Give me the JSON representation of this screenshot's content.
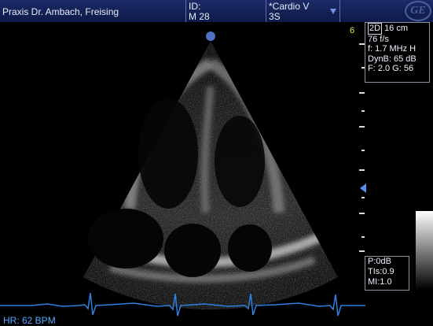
{
  "header": {
    "practice": "Praxis Dr. Ambach,  Freising",
    "patient_id_label": "ID:",
    "patient_id_value": "M 28",
    "preset": "*Cardio V",
    "probe": "3S",
    "logo_text": "GE"
  },
  "imaging_params": {
    "mode": "2D",
    "depth": "16 cm",
    "frame_rate": "76 f/s",
    "frequency": "f: 1.7 MHz H",
    "dynamic_range": "DynB: 65 dB",
    "frame_and_gain": "F: 2.0    G: 56"
  },
  "safety": {
    "power": "P:0dB",
    "tis": "TIs:0.9",
    "mi": "MI:1.0"
  },
  "depth_scale_label": "6",
  "heart_rate": "HR: 62 BPM",
  "colors": {
    "header_bg": "#142260",
    "accent_blue": "#4f6fc3",
    "ecg_trace": "#2f7fe0",
    "depth_label": "#f0e35a"
  }
}
